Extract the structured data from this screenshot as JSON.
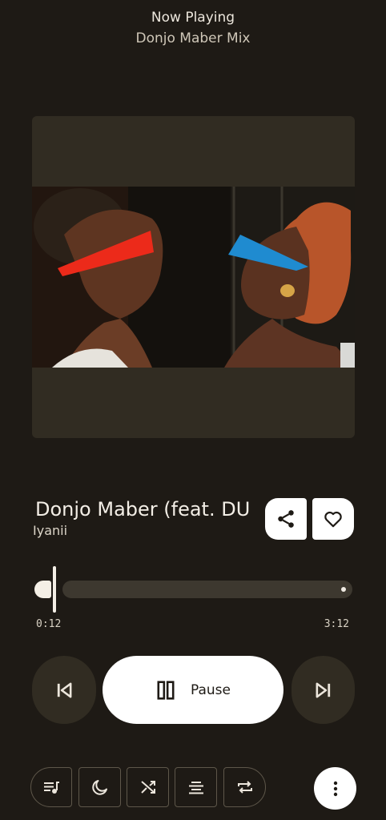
{
  "header": {
    "title": "Now Playing",
    "subtitle": "Donjo Maber Mix"
  },
  "track": {
    "title": "Donjo Maber (feat. DUI",
    "artist": "Iyanii",
    "current_time": "0:12",
    "total_time": "3:12",
    "progress": 0.0625
  },
  "controls": {
    "pause_label": "Pause"
  },
  "icons": {
    "share": "share-icon",
    "favorite": "heart-outline-icon",
    "previous": "skip-previous-icon",
    "next": "skip-next-icon",
    "pause": "pause-icon",
    "queue": "queue-music-icon",
    "sleep": "moon-icon",
    "shuffle": "shuffle-icon",
    "lyrics": "lyrics-lines-icon",
    "repeat": "repeat-icon",
    "more": "more-vertical-icon"
  },
  "colors": {
    "background": "#1e1a15",
    "surface": "#312c22",
    "accent": "#ffffff",
    "track_bg": "#3d382f"
  }
}
